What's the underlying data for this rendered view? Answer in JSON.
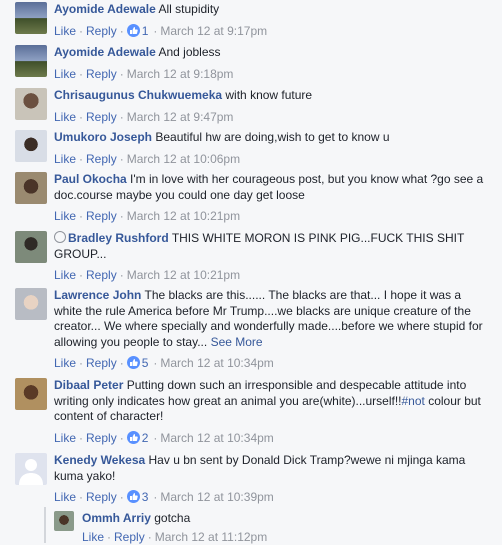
{
  "comments": [
    {
      "name": "Ayomide Adewale",
      "text": "All stupidity",
      "like": "Like",
      "reply": "Reply",
      "likes": "1",
      "time": "March 12 at 9:17pm",
      "avatar": "landscape"
    },
    {
      "name": "Ayomide Adewale",
      "text": "And jobless",
      "like": "Like",
      "reply": "Reply",
      "likes": "",
      "time": "March 12 at 9:18pm",
      "avatar": "landscape"
    },
    {
      "name": "Chrisaugunus Chukwuemeka",
      "text": "with know future",
      "like": "Like",
      "reply": "Reply",
      "likes": "",
      "time": "March 12 at 9:47pm",
      "avatar": "person"
    },
    {
      "name": "Umukoro Joseph",
      "text": "Beautiful hw are doing,wish to get to know u",
      "like": "Like",
      "reply": "Reply",
      "likes": "",
      "time": "March 12 at 10:06pm",
      "avatar": "person"
    },
    {
      "name": "Paul Okocha",
      "text": "I'm in love with her courageous post, but you know what ?go see a doc.course maybe you could one day get loose",
      "like": "Like",
      "reply": "Reply",
      "likes": "",
      "time": "March 12 at 10:21pm",
      "avatar": "person"
    },
    {
      "name": "Bradley Rushford",
      "text": "THIS WHITE MORON IS PINK PIG...FUCK THIS SHIT GROUP...",
      "like": "Like",
      "reply": "Reply",
      "likes": "",
      "time": "March 12 at 10:21pm",
      "avatar": "person"
    },
    {
      "name": "Lawrence John",
      "text": "The blacks are this...... The blacks are that... I hope it was a white the rule America before Mr Trump....we blacks are unique creature of the creator... We where specially and wonderfully made....before we where stupid for allowing you people to stay...",
      "see_more": "See More",
      "like": "Like",
      "reply": "Reply",
      "likes": "5",
      "time": "March 12 at 10:34pm",
      "avatar": "baby"
    },
    {
      "name": "Dibaal Peter",
      "text_a": "Putting down such an irresponsible and despecable attitude into writing only indicates how great an animal you are(white)...urself!!",
      "hashtag": "#not",
      "text_b": " colour but content of character!",
      "like": "Like",
      "reply": "Reply",
      "likes": "2",
      "time": "March 12 at 10:34pm",
      "avatar": "person"
    },
    {
      "name": "Kenedy Wekesa",
      "text": "Hav u bn sent by Donald Dick Tramp?wewe ni mjinga kama kuma yako!",
      "like": "Like",
      "reply": "Reply",
      "likes": "3",
      "time": "March 12 at 10:39pm",
      "avatar": "default"
    }
  ],
  "reply": {
    "name": "Ommh Arriy",
    "text": "gotcha",
    "like": "Like",
    "reply": "Reply",
    "time": "March 12 at 11:12pm",
    "avatar": "person"
  },
  "colors": {
    "link": "#365899",
    "meta": "#90949c",
    "like_blue": "#5890ff"
  },
  "icons": {
    "like_badge": "thumbs-up-icon",
    "verified": "verified-circle-icon"
  }
}
